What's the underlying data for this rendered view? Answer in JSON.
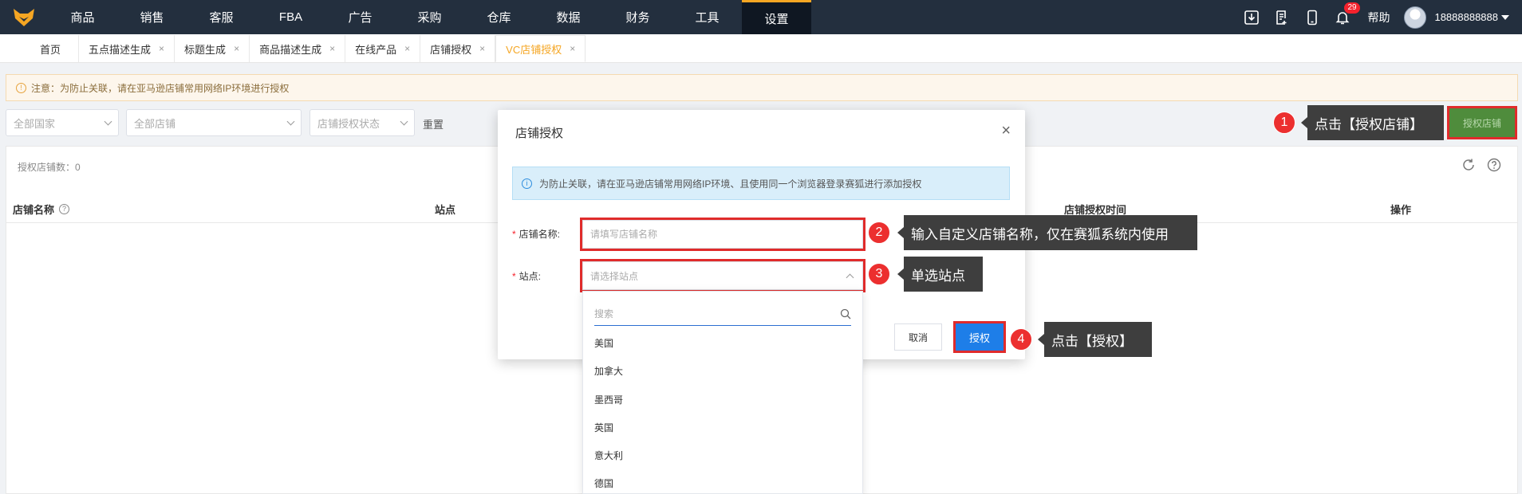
{
  "nav": {
    "items": [
      "商品",
      "销售",
      "客服",
      "FBA",
      "广告",
      "采购",
      "仓库",
      "数据",
      "财务",
      "工具",
      "设置"
    ],
    "active_index": 10,
    "notification_count": "29",
    "help_label": "帮助",
    "username": "18888888888"
  },
  "tabs": [
    {
      "label": "首页",
      "closable": false
    },
    {
      "label": "五点描述生成",
      "closable": true
    },
    {
      "label": "标题生成",
      "closable": true
    },
    {
      "label": "商品描述生成",
      "closable": true
    },
    {
      "label": "在线产品",
      "closable": true
    },
    {
      "label": "店铺授权",
      "closable": true
    },
    {
      "label": "VC店铺授权",
      "closable": true,
      "active": true
    }
  ],
  "notice": {
    "text": "注意：为防止关联，请在亚马逊店铺常用网络IP环境进行授权"
  },
  "filters": {
    "country": "全部国家",
    "shop": "全部店铺",
    "status": "店铺授权状态",
    "reset": "重置"
  },
  "auth_shop_button": "授权店铺",
  "panel": {
    "count_label": "授权店铺数：0",
    "columns": [
      "店铺名称",
      "站点",
      "店铺授权时间",
      "操作"
    ]
  },
  "modal": {
    "title": "店铺授权",
    "info": "为防止关联，请在亚马逊店铺常用网络IP环境、且使用同一个浏览器登录赛狐进行添加授权",
    "shop_name_label": "店铺名称:",
    "shop_name_placeholder": "请填写店铺名称",
    "site_label": "站点:",
    "site_placeholder": "请选择站点",
    "cancel": "取消",
    "authorize": "授权"
  },
  "dropdown": {
    "search_placeholder": "搜索",
    "options": [
      "美国",
      "加拿大",
      "墨西哥",
      "英国",
      "意大利",
      "德国"
    ]
  },
  "callouts": [
    {
      "num": "1",
      "text": "点击【授权店铺】"
    },
    {
      "num": "2",
      "text": "输入自定义店铺名称，仅在赛狐系统内使用"
    },
    {
      "num": "3",
      "text": "单选站点"
    },
    {
      "num": "4",
      "text": "点击【授权】"
    }
  ],
  "colors": {
    "nav_bg": "#232f3e",
    "accent": "#f5a623",
    "primary": "#1e7ee8",
    "highlight": "#e02b2b",
    "auth_button": "#4f8c3c"
  }
}
